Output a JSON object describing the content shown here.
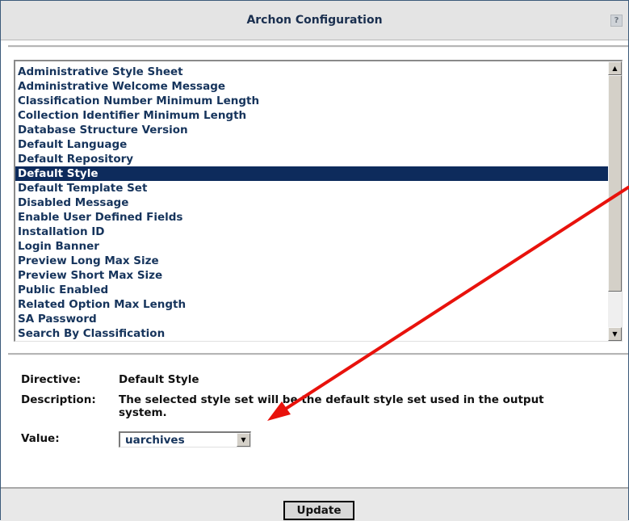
{
  "window": {
    "title": "Archon Configuration",
    "help_glyph": "?"
  },
  "config_list": {
    "items": [
      "Administrative Style Sheet",
      "Administrative Welcome Message",
      "Classification Number Minimum Length",
      "Collection Identifier Minimum Length",
      "Database Structure Version",
      "Default Language",
      "Default Repository",
      "Default Style",
      "Default Template Set",
      "Disabled Message",
      "Enable User Defined Fields",
      "Installation ID",
      "Login Banner",
      "Preview Long Max Size",
      "Preview Short Max Size",
      "Public Enabled",
      "Related Option Max Length",
      "SA Password",
      "Search By Classification"
    ],
    "selected_index": 7,
    "scroll_up_glyph": "▲",
    "scroll_down_glyph": "▼"
  },
  "details": {
    "directive_label": "Directive:",
    "directive_value": "Default Style",
    "description_label": "Description:",
    "description_value": "The selected style set will be the default style set used in the output system.",
    "value_label": "Value:",
    "value_selected": "uarchives",
    "dropdown_glyph": "▼"
  },
  "footer": {
    "update_label": "Update"
  },
  "annotation": {
    "arrow_color": "#e8120c"
  },
  "colors": {
    "selected_bg": "#0d2b5c",
    "text_blue": "#16345c",
    "title_text": "#1a2f4f"
  }
}
